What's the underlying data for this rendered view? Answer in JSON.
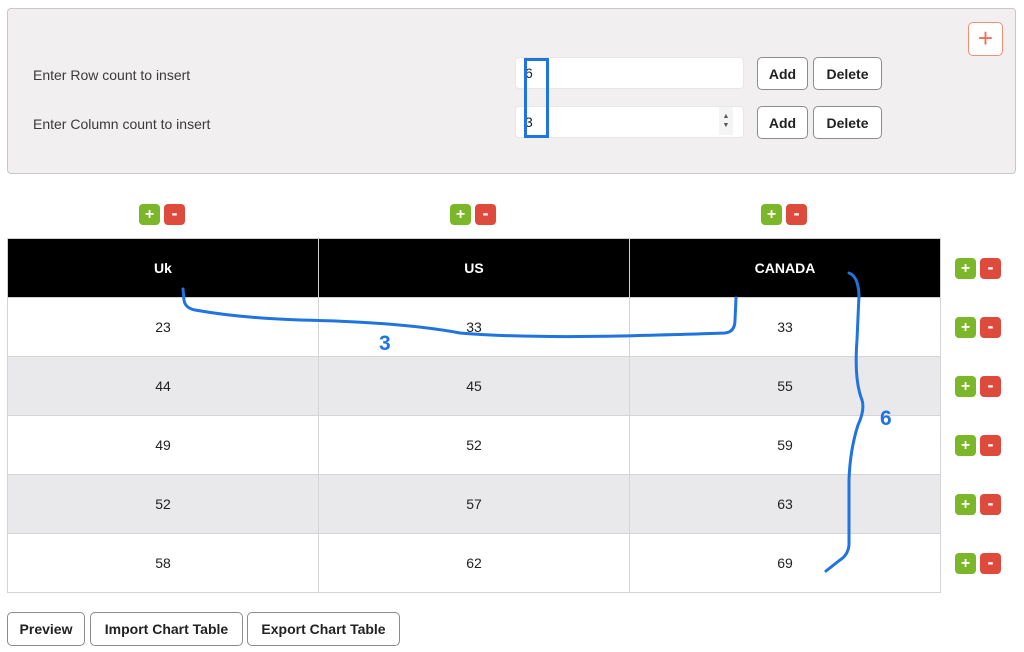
{
  "insert_panel": {
    "add_icon": "plus-icon",
    "row": {
      "label": "Enter Row count to insert",
      "value": "6",
      "add_label": "Add",
      "delete_label": "Delete"
    },
    "column": {
      "label": "Enter Column count to insert",
      "value": "3",
      "add_label": "Add",
      "delete_label": "Delete",
      "spinner_up": "▲",
      "spinner_down": "▼"
    }
  },
  "table": {
    "column_controls": {
      "plus": "+",
      "minus": "-"
    },
    "row_controls": {
      "plus": "+",
      "minus": "-"
    },
    "headers": [
      "Uk",
      "US",
      "CANADA"
    ],
    "rows": [
      [
        "23",
        "33",
        "33"
      ],
      [
        "44",
        "45",
        "55"
      ],
      [
        "49",
        "52",
        "59"
      ],
      [
        "52",
        "57",
        "63"
      ],
      [
        "58",
        "62",
        "69"
      ]
    ]
  },
  "annotations": {
    "columns_label": "3",
    "rows_label": "6",
    "color": "#1f74e0"
  },
  "footer": {
    "preview_label": "Preview",
    "import_label": "Import Chart Table",
    "export_label": "Export Chart Table"
  }
}
